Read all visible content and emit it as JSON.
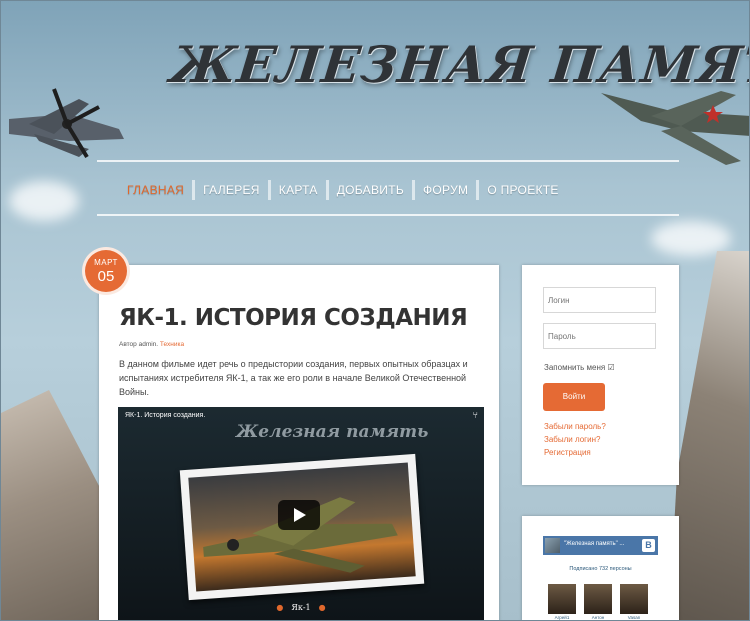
{
  "site": {
    "logo_text": "ЖЕЛЕЗНАЯ ПАМЯТЬ"
  },
  "nav": {
    "items": [
      {
        "label": "ГЛАВНАЯ",
        "active": true
      },
      {
        "label": "ГАЛЕРЕЯ",
        "active": false
      },
      {
        "label": "КАРТА",
        "active": false
      },
      {
        "label": "ДОБАВИТЬ",
        "active": false
      },
      {
        "label": "ФОРУМ",
        "active": false
      },
      {
        "label": "О ПРОЕКТЕ",
        "active": false
      }
    ]
  },
  "post": {
    "date_month": "МАРТ",
    "date_day": "05",
    "title": "ЯК-1. ИСТОРИЯ СОЗДАНИЯ",
    "meta_prefix": "Автор admin.",
    "category": "Техника",
    "excerpt": "В данном фильме идет речь о предыстории создания, первых опытных образцах и испытаниях истребителя ЯК-1, а так же его роли в начале Великой Отечественной Войны."
  },
  "video": {
    "title": "ЯК-1. История создания.",
    "logo_text": "Железная память",
    "caption": "Як-1"
  },
  "login": {
    "login_placeholder": "Логин",
    "password_placeholder": "Пароль",
    "remember_label": "Запомнить меня",
    "submit_label": "Войти",
    "forgot_password": "Забыли пароль?",
    "forgot_login": "Забыли логин?",
    "register": "Регистрация"
  },
  "vk_widget": {
    "group_name": "\"Железная память\" ...",
    "logo": "В",
    "subscribers": "Подписано 732 персоны",
    "members": [
      {
        "name": "Агрей1"
      },
      {
        "name": "Антон"
      },
      {
        "name": "Vasan"
      }
    ]
  },
  "colors": {
    "accent": "#e56a34",
    "vk_blue": "#4a76a8"
  }
}
